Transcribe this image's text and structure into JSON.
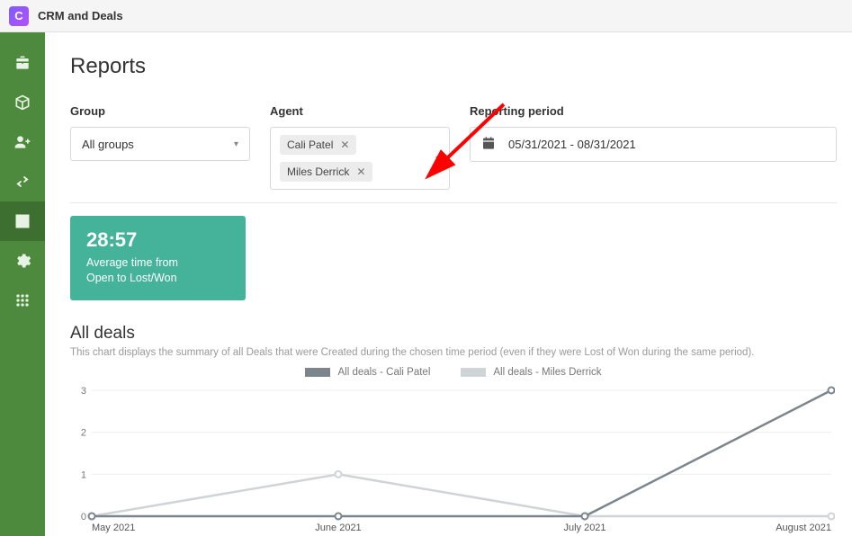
{
  "app": {
    "title": "CRM and Deals",
    "logo_letter": "C"
  },
  "page": {
    "title": "Reports"
  },
  "filters": {
    "group": {
      "label": "Group",
      "value": "All groups"
    },
    "agent": {
      "label": "Agent",
      "tags": [
        {
          "name": "Cali Patel"
        },
        {
          "name": "Miles Derrick"
        }
      ]
    },
    "period": {
      "label": "Reporting period",
      "value": "05/31/2021 - 08/31/2021"
    }
  },
  "metric": {
    "value": "28:57",
    "label_line1": "Average time from",
    "label_line2": "Open to Lost/Won"
  },
  "section": {
    "title": "All deals",
    "subtitle": "This chart displays the summary of all Deals that were Created during the chosen time period (even if they were Lost of Won during the same period)."
  },
  "chart_data": {
    "type": "line",
    "categories": [
      "May 2021",
      "June 2021",
      "July 2021",
      "August 2021"
    ],
    "series": [
      {
        "name": "All deals - Cali Patel",
        "color": "#7b858b",
        "values": [
          0,
          0,
          0,
          3
        ]
      },
      {
        "name": "All deals - Miles Derrick",
        "color": "#cfd4d7",
        "values": [
          0,
          1,
          0,
          0
        ]
      }
    ],
    "ylim": [
      0,
      3
    ],
    "yticks": [
      0,
      1,
      2,
      3
    ]
  },
  "colors": {
    "sidebar_bg": "#4d8a3d",
    "metric_bg": "#44b39a"
  }
}
